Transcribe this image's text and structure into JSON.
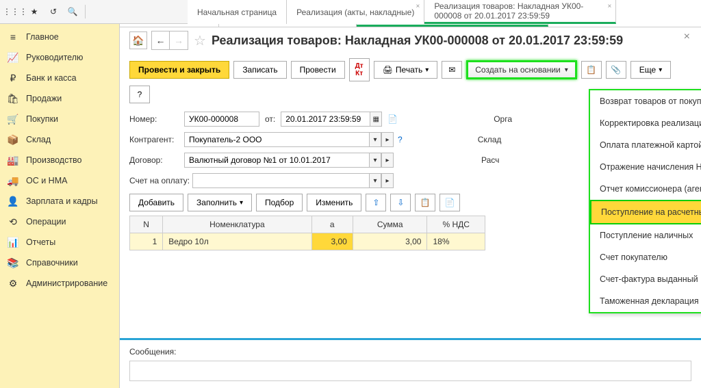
{
  "top_icons": [
    "apps",
    "star",
    "history",
    "search"
  ],
  "tabs": [
    {
      "label": "Начальная страница",
      "active": false,
      "closable": false
    },
    {
      "label": "Реализация (акты, накладные)",
      "active": false,
      "closable": true
    },
    {
      "label": "Реализация товаров: Накладная УК00-000008 от 20.01.2017 23:59:59",
      "active": true,
      "closable": true
    }
  ],
  "sidebar": [
    {
      "icon": "≡",
      "label": "Главное"
    },
    {
      "icon": "📈",
      "label": "Руководителю"
    },
    {
      "icon": "₽",
      "label": "Банк и касса"
    },
    {
      "icon": "🛍",
      "label": "Продажи"
    },
    {
      "icon": "🛒",
      "label": "Покупки"
    },
    {
      "icon": "📦",
      "label": "Склад"
    },
    {
      "icon": "🏭",
      "label": "Производство"
    },
    {
      "icon": "🚚",
      "label": "ОС и НМА"
    },
    {
      "icon": "👤",
      "label": "Зарплата и кадры"
    },
    {
      "icon": "⟲",
      "label": "Операции"
    },
    {
      "icon": "📊",
      "label": "Отчеты"
    },
    {
      "icon": "📚",
      "label": "Справочники"
    },
    {
      "icon": "⚙",
      "label": "Администрирование"
    }
  ],
  "page_title": "Реализация товаров: Накладная УК00-000008 от 20.01.2017 23:59:59",
  "toolbar": {
    "post_close": "Провести и закрыть",
    "save": "Записать",
    "post": "Провести",
    "print": "Печать",
    "create_basis": "Создать на основании",
    "more": "Еще"
  },
  "form": {
    "number_label": "Номер:",
    "number": "УК00-000008",
    "date_label": "от:",
    "date": "20.01.2017 23:59:59",
    "contractor_label": "Контрагент:",
    "contractor": "Покупатель-2 ООО",
    "contract_label": "Договор:",
    "contract": "Валютный договор №1 от 10.01.2017",
    "invoice_label": "Счет на оплату:",
    "invoice": "",
    "org_label": "Орга",
    "warehouse_label": "Склад",
    "account_label": "Расч"
  },
  "table_toolbar": {
    "add": "Добавить",
    "fill": "Заполнить",
    "select": "Подбор",
    "change": "Изменить"
  },
  "table": {
    "headers": [
      "N",
      "Номенклатура",
      "а",
      "Сумма",
      "% НДС"
    ],
    "rows": [
      {
        "n": "1",
        "name": "Ведро 10л",
        "price": "3,00",
        "sum": "3,00",
        "vat": "18%"
      }
    ]
  },
  "basis_menu": [
    "Возврат товаров от покупателя",
    "Корректировка реализации",
    "Оплата платежной картой",
    "Отражение начисления НДС",
    "Отчет комиссионера (агента) о продажах",
    "Поступление на расчетный счет",
    "Поступление наличных",
    "Счет покупателю",
    "Счет-фактура выданный",
    "Таможенная декларация (экспорт)"
  ],
  "basis_highlighted_index": 5,
  "messages_title": "Сообщения:"
}
